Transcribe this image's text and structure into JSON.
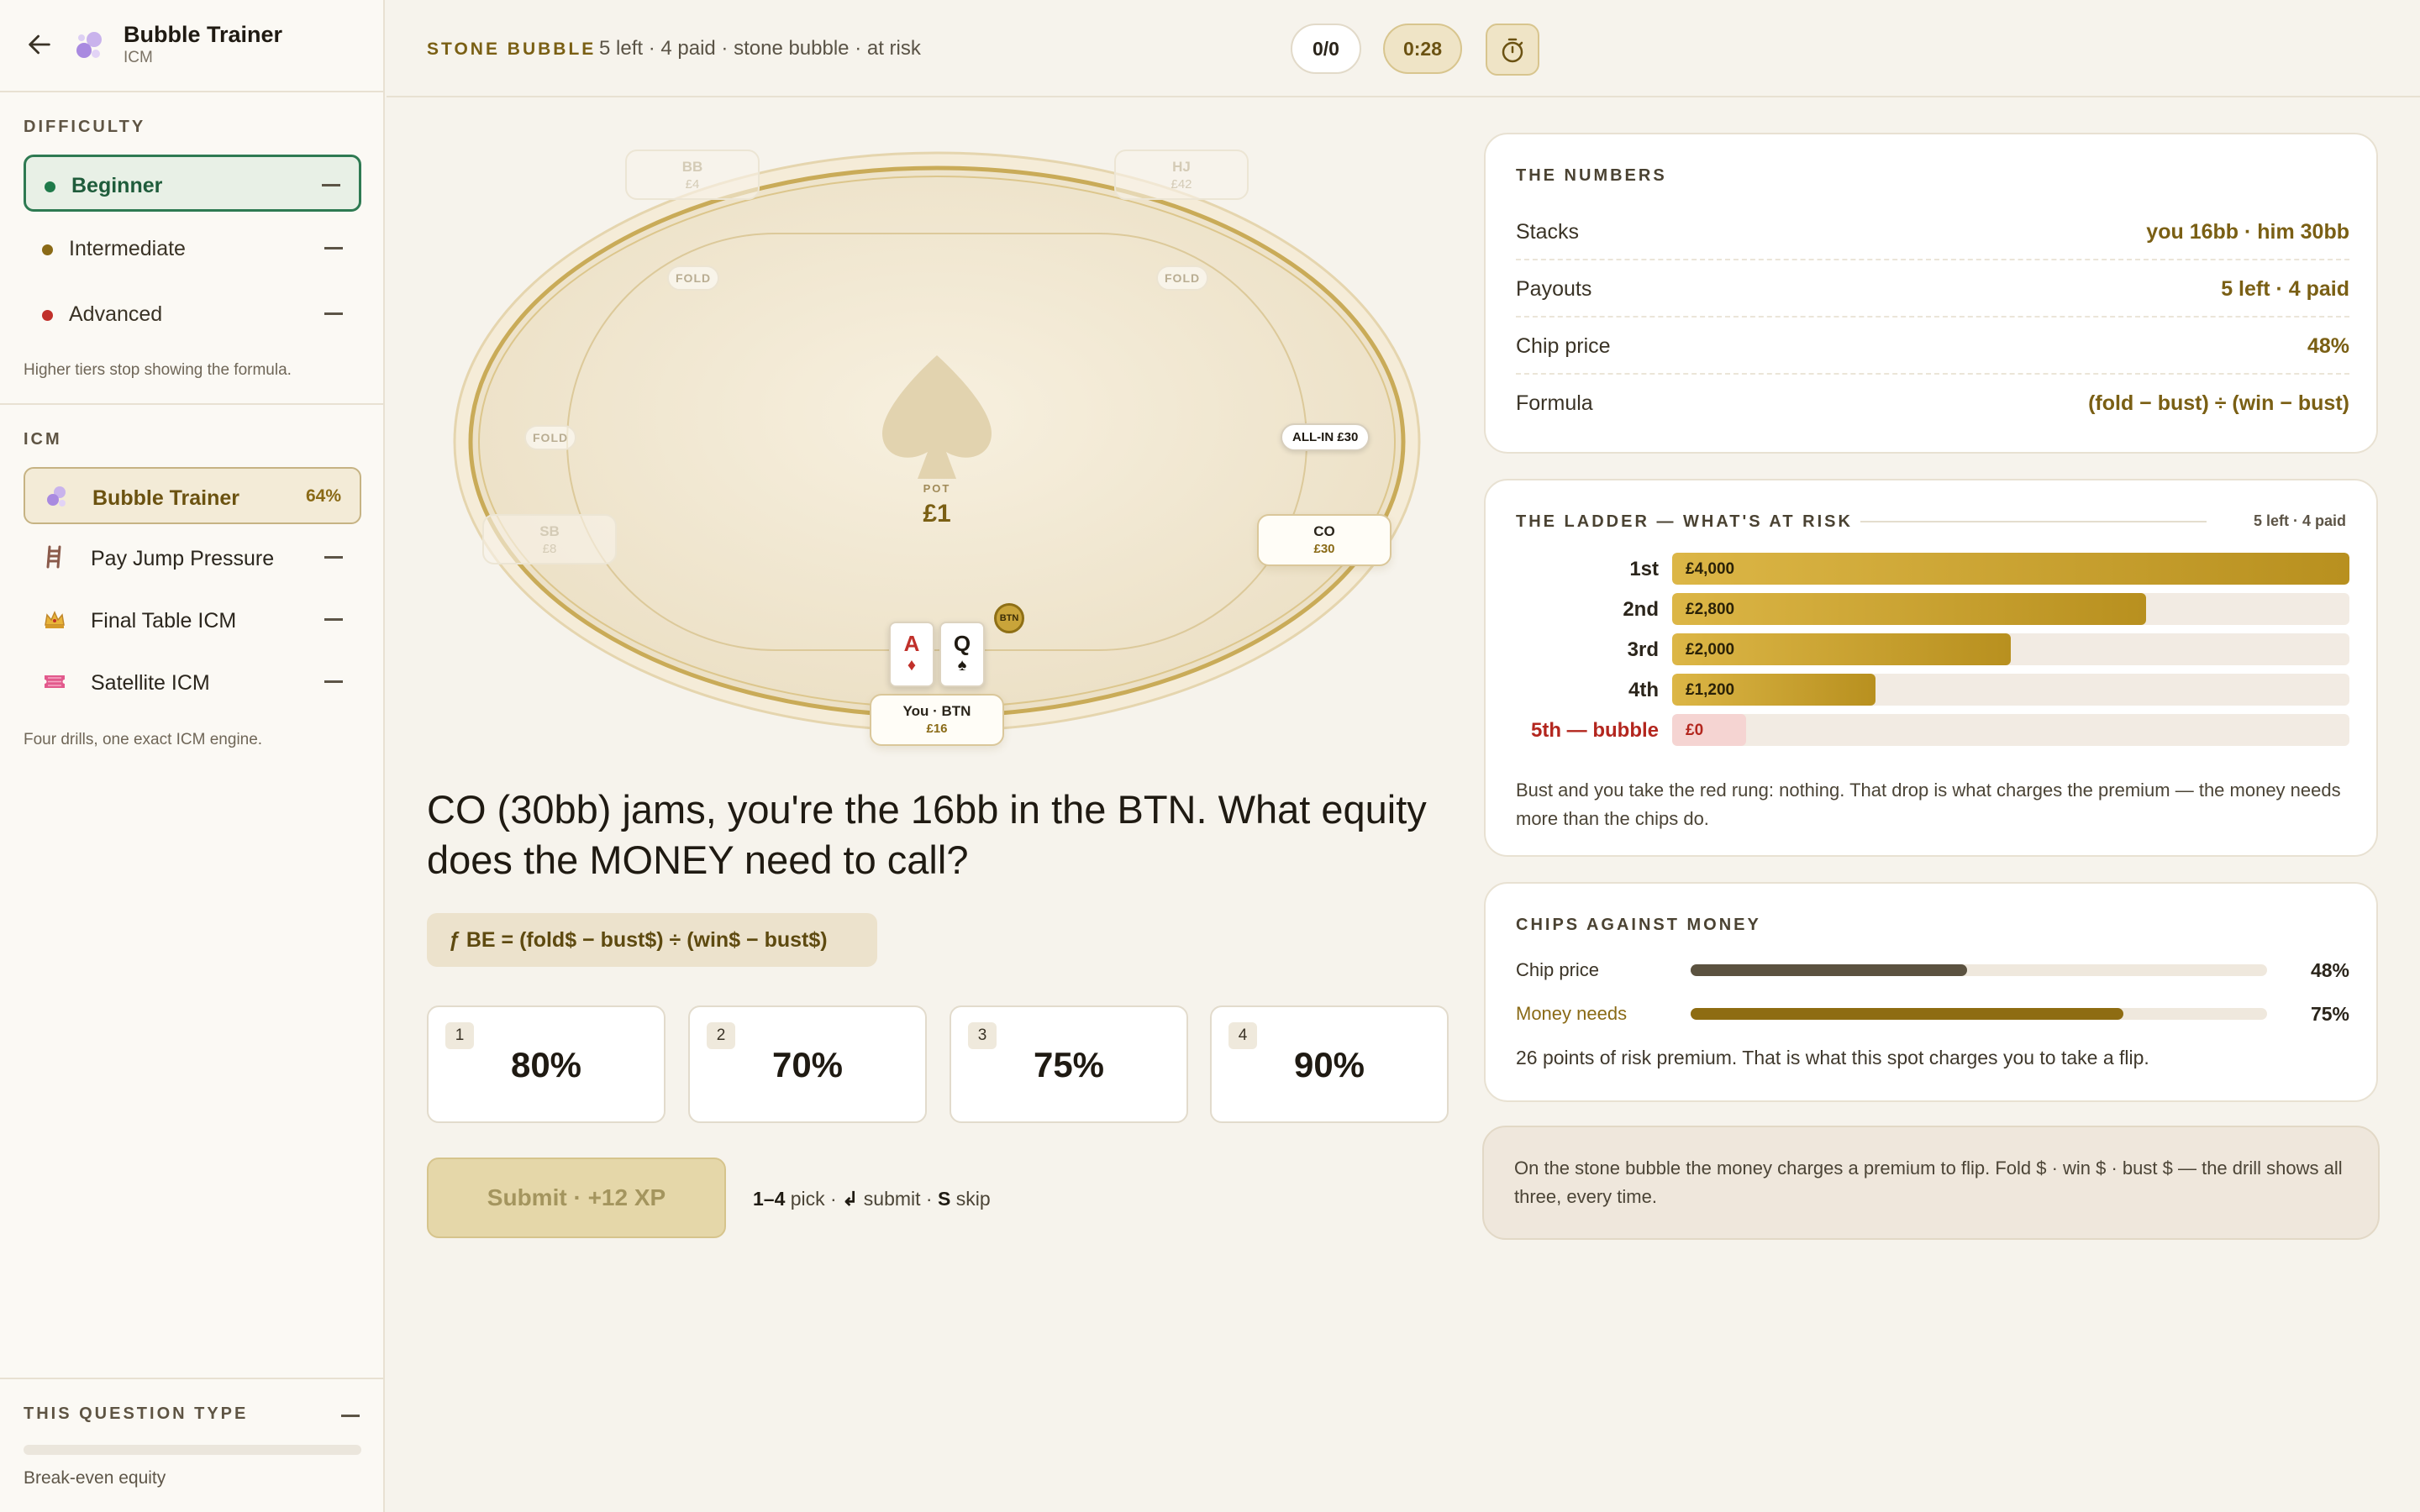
{
  "app": {
    "title": "Bubble Trainer",
    "subtitle": "ICM"
  },
  "sidebar": {
    "difficulty_label": "DIFFICULTY",
    "difficulties": [
      {
        "label": "Beginner",
        "color": "#1f7a4a",
        "active": true
      },
      {
        "label": "Intermediate",
        "color": "#8a6a16",
        "active": false
      },
      {
        "label": "Advanced",
        "color": "#c0302a",
        "active": false
      }
    ],
    "difficulty_note": "Higher tiers stop showing the formula.",
    "icm_label": "ICM",
    "icm_items": [
      {
        "label": "Bubble Trainer",
        "badge": "64%",
        "icon": "bubbles-icon",
        "active": true
      },
      {
        "label": "Pay Jump Pressure",
        "icon": "ladder-icon"
      },
      {
        "label": "Final Table ICM",
        "icon": "crown-icon"
      },
      {
        "label": "Satellite ICM",
        "icon": "ticket-icon"
      }
    ],
    "icm_note": "Four drills, one exact ICM engine.",
    "question_type_label": "THIS QUESTION TYPE",
    "question_type": "Break-even equity"
  },
  "topbar": {
    "tag": "STONE BUBBLE",
    "subtitle": "5 left · 4 paid · stone bubble · at risk",
    "score": "0/0",
    "timer": "0:28"
  },
  "table": {
    "seats": {
      "bb": {
        "name": "BB",
        "stack": "£4"
      },
      "hj": {
        "name": "HJ",
        "stack": "£42"
      },
      "sb": {
        "name": "SB",
        "stack": "£8"
      },
      "co": {
        "name": "CO",
        "stack": "£30"
      },
      "you": {
        "name": "You · BTN",
        "stack": "£16"
      }
    },
    "fold_label": "FOLD",
    "allin_label": "ALL-IN £30",
    "pot_label": "POT",
    "pot_value": "£1",
    "dealer_label": "BTN",
    "hole_cards": [
      {
        "rank": "A",
        "suit": "♦",
        "color": "#c0302a"
      },
      {
        "rank": "Q",
        "suit": "♠",
        "color": "#1f1a12"
      }
    ]
  },
  "question": {
    "text": "CO (30bb) jams, you're the 16bb in the BTN. What equity does the MONEY need to call?",
    "formula": "ƒ BE = (fold$ − bust$) ÷ (win$ − bust$)",
    "options": [
      {
        "key": "1",
        "value": "80%"
      },
      {
        "key": "2",
        "value": "70%"
      },
      {
        "key": "3",
        "value": "75%"
      },
      {
        "key": "4",
        "value": "90%"
      }
    ],
    "submit_label": "Submit · +12 XP",
    "hint_pick_key": "1–4",
    "hint_pick": "pick ·",
    "hint_submit_key": "↲",
    "hint_submit": "submit ·",
    "hint_skip_key": "S",
    "hint_skip": "skip"
  },
  "numbers": {
    "title": "THE NUMBERS",
    "rows": [
      {
        "label": "Stacks",
        "value": "you 16bb · him 30bb"
      },
      {
        "label": "Payouts",
        "value": "5 left · 4 paid"
      },
      {
        "label": "Chip price",
        "value": "48%"
      },
      {
        "label": "Formula",
        "value": "(fold − bust) ÷ (win − bust)"
      }
    ]
  },
  "ladder": {
    "title": "THE LADDER — WHAT'S AT RISK",
    "meta": "5 left · 4 paid",
    "rungs": [
      {
        "place": "1st",
        "prize": "£4,000",
        "amount": 4000
      },
      {
        "place": "2nd",
        "prize": "£2,800",
        "amount": 2800
      },
      {
        "place": "3rd",
        "prize": "£2,000",
        "amount": 2000
      },
      {
        "place": "4th",
        "prize": "£1,200",
        "amount": 1200
      },
      {
        "place": "5th — bubble",
        "prize": "£0",
        "amount": 0
      }
    ],
    "note": "Bust and you take the red rung: nothing. That drop is what charges the premium — the money needs more than the chips do."
  },
  "chips_vs_money": {
    "title": "CHIPS AGAINST MONEY",
    "rows": [
      {
        "label": "Chip price",
        "value": "48%",
        "fraction": 0.48,
        "color": "#5b5240",
        "label_color": "#3a3326"
      },
      {
        "label": "Money needs",
        "value": "75%",
        "fraction": 0.75,
        "color": "#8e6c12",
        "label_color": "#8a6a16"
      }
    ],
    "note": "26 points of risk premium. That is what this spot charges you to take a flip."
  },
  "footer_note": "On the stone bubble the money charges a premium to flip. Fold $ · win $ · bust $ — the drill shows all three, every time."
}
